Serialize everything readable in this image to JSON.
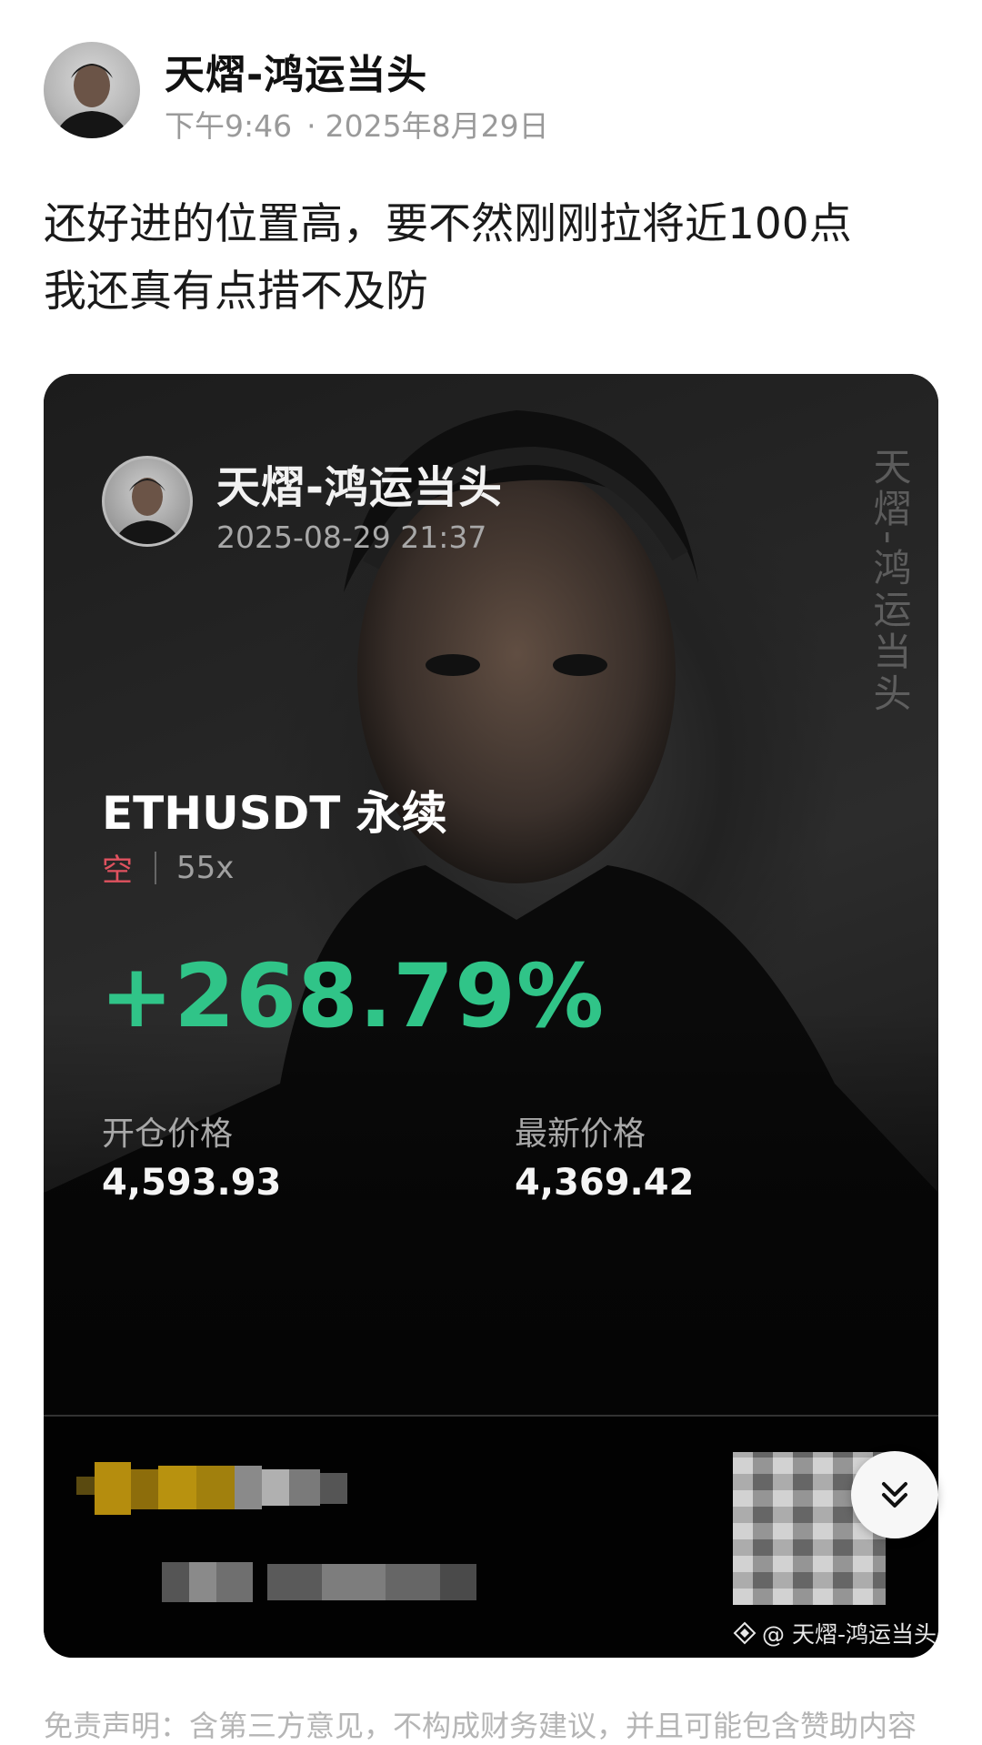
{
  "post": {
    "author": "天熠-鸿运当头",
    "time": "下午9:46",
    "dot": "·",
    "date": "2025年8月29日",
    "lines": [
      "还好进的位置高，要不然刚刚拉将近100点",
      "我还真有点措不及防"
    ]
  },
  "card": {
    "author": "天熠-鸿运当头",
    "timestamp": "2025-08-29 21:37",
    "watermark": "天熠-鸿运当头",
    "pair": "ETHUSDT 永续",
    "side": "空",
    "leverage": "55x",
    "pnl": "+268.79%",
    "entry_label": "开仓价格",
    "entry_value": "4,593.93",
    "mark_label": "最新价格",
    "mark_value": "4,369.42",
    "footer_credit": "@ 天熠-鸿运当头",
    "colors": {
      "pnl": "#30c488",
      "short": "#e0525f"
    }
  },
  "disclaimer": "免责声明：含第三方意见，不构成财务建议，并且可能包含赞助内容"
}
